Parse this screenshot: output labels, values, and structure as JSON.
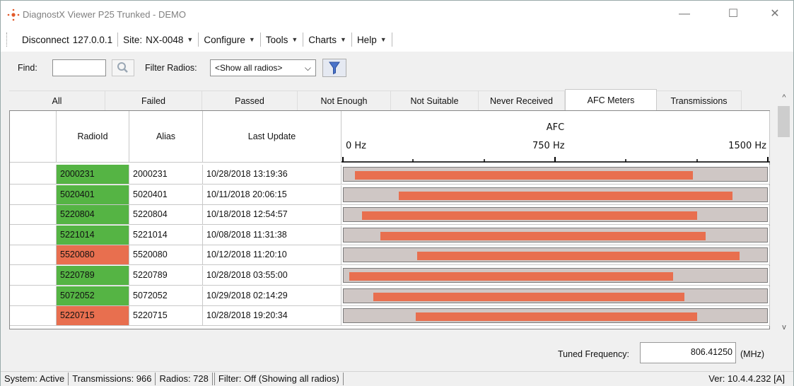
{
  "window": {
    "title": "DiagnostX Viewer P25 Trunked - DEMO",
    "controls": {
      "minimize": "—",
      "maximize": "☐",
      "close": "✕"
    }
  },
  "menu": {
    "disconnect": "Disconnect",
    "address": "127.0.0.1",
    "site_label": "Site:",
    "site_value": "NX-0048",
    "configure": "Configure",
    "tools": "Tools",
    "charts": "Charts",
    "help": "Help",
    "caret": "▼"
  },
  "findbar": {
    "find_label": "Find:",
    "find_value": "",
    "filter_label": "Filter Radios:",
    "filter_value": "<Show all radios>",
    "filter_caret": "⌵"
  },
  "tabs": [
    "All",
    "Failed",
    "Passed",
    "Not Enough",
    "Not Suitable",
    "Never Received",
    "AFC Meters",
    "Transmissions"
  ],
  "active_tab": "AFC Meters",
  "table": {
    "headers": {
      "radio_id": "RadioId",
      "alias": "Alias",
      "last_update": "Last Update",
      "afc": "AFC"
    },
    "afc_scale": {
      "min_label": "0 Hz",
      "mid_label": "750 Hz",
      "max_label": "1500 Hz",
      "min": 0,
      "max": 1500
    },
    "rows": [
      {
        "radio_id": "2000231",
        "alias": "2000231",
        "last_update": "10/28/2018 13:19:36",
        "status": "pass",
        "afc_low": 40,
        "afc_high": 1240
      },
      {
        "radio_id": "5020401",
        "alias": "5020401",
        "last_update": "10/11/2018 20:06:15",
        "status": "pass",
        "afc_low": 195,
        "afc_high": 1380
      },
      {
        "radio_id": "5220804",
        "alias": "5220804",
        "last_update": "10/18/2018 12:54:57",
        "status": "pass",
        "afc_low": 65,
        "afc_high": 1255
      },
      {
        "radio_id": "5221014",
        "alias": "5221014",
        "last_update": "10/08/2018 11:31:38",
        "status": "pass",
        "afc_low": 130,
        "afc_high": 1285
      },
      {
        "radio_id": "5520080",
        "alias": "5520080",
        "last_update": "10/12/2018 11:20:10",
        "status": "fail",
        "afc_low": 260,
        "afc_high": 1405
      },
      {
        "radio_id": "5220789",
        "alias": "5220789",
        "last_update": "10/28/2018 03:55:00",
        "status": "pass",
        "afc_low": 20,
        "afc_high": 1170
      },
      {
        "radio_id": "5072052",
        "alias": "5072052",
        "last_update": "10/29/2018 02:14:29",
        "status": "pass",
        "afc_low": 105,
        "afc_high": 1210
      },
      {
        "radio_id": "5220715",
        "alias": "5220715",
        "last_update": "10/28/2018 19:20:34",
        "status": "fail",
        "afc_low": 255,
        "afc_high": 1255
      }
    ]
  },
  "scrollbar": {
    "up": "^",
    "down": "v"
  },
  "tuned": {
    "label": "Tuned Frequency:",
    "value": "806.41250",
    "unit": "(MHz)"
  },
  "status": {
    "system": "System: Active",
    "transmissions": "Transmissions: 966",
    "radios": "Radios: 728",
    "filter": "Filter: Off (Showing all radios)",
    "version": "Ver: 10.4.4.232 [A]"
  },
  "colors": {
    "pass": "#55b444",
    "fail": "#e86f4f",
    "bar": "#e86f4f",
    "track": "#cfc7c5"
  }
}
